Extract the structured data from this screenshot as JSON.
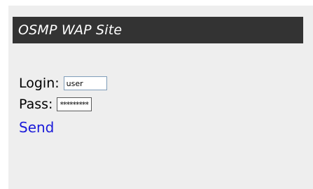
{
  "header": {
    "title": "OSMP WAP Site"
  },
  "form": {
    "login_label": "Login:",
    "login_value": "user",
    "pass_label": "Pass:",
    "pass_value": "*********",
    "send_label": "Send"
  },
  "colors": {
    "background": "#eeeeee",
    "title_bar": "#333333",
    "link": "#1a1ad9"
  }
}
